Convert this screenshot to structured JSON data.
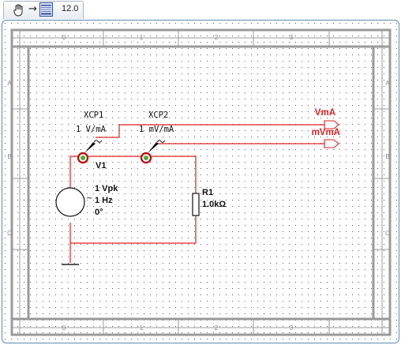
{
  "toolbar": {
    "pan_tool_icon": "hand-icon",
    "arrow_icon": "arrow-right-icon",
    "sheet_icon": "schematic-sheet-icon",
    "arrow_glyph": "→",
    "zoom_value": "12.0"
  },
  "border": {
    "col_numbers": [
      "0",
      "1",
      "2",
      "3"
    ],
    "row_letters": [
      "A",
      "B",
      "C"
    ]
  },
  "components": {
    "xcp1": {
      "ref": "XCP1",
      "scale": "1 V/mA"
    },
    "xcp2": {
      "ref": "XCP2",
      "scale": "1 mV/mA"
    },
    "v1": {
      "ref": "V1",
      "amplitude": "1 Vpk",
      "frequency": "1 Hz",
      "phase": "0°",
      "tilde": "~"
    },
    "r1": {
      "ref": "R1",
      "value": "1.0kΩ"
    }
  },
  "connectors": {
    "out1": "VmA",
    "out2": "mVmA"
  },
  "colors": {
    "wire": "#e02020",
    "label": "#e02020",
    "border": "#9a9a9a",
    "frame": "#5a8ab6"
  }
}
